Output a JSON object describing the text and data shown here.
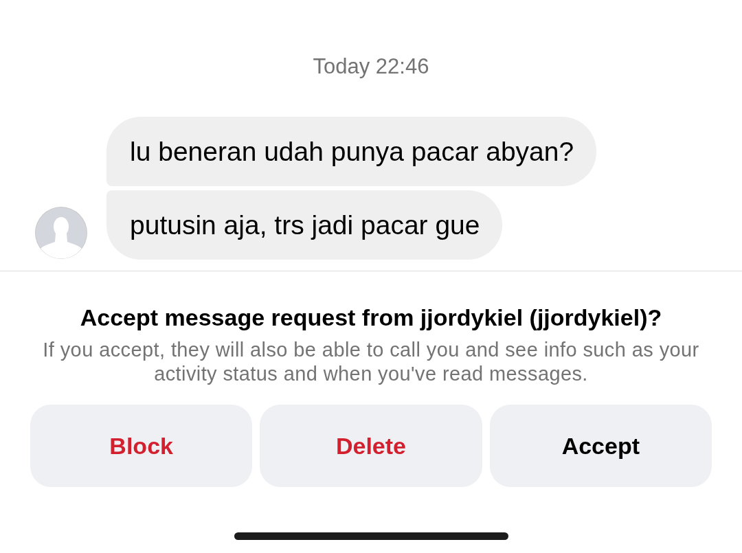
{
  "timestamp": "Today 22:46",
  "messages": [
    {
      "text": "lu beneran udah punya pacar abyan?"
    },
    {
      "text": "putusin aja, trs jadi pacar gue"
    }
  ],
  "request": {
    "title": "Accept message request from jjordykiel (jjordykiel)?",
    "description": "If you accept, they will also be able to call you and see info such as your activity status and when you've read messages."
  },
  "buttons": [
    {
      "label": "Block",
      "kind": "destructive"
    },
    {
      "label": "Delete",
      "kind": "destructive"
    },
    {
      "label": "Accept",
      "kind": "normal"
    }
  ]
}
